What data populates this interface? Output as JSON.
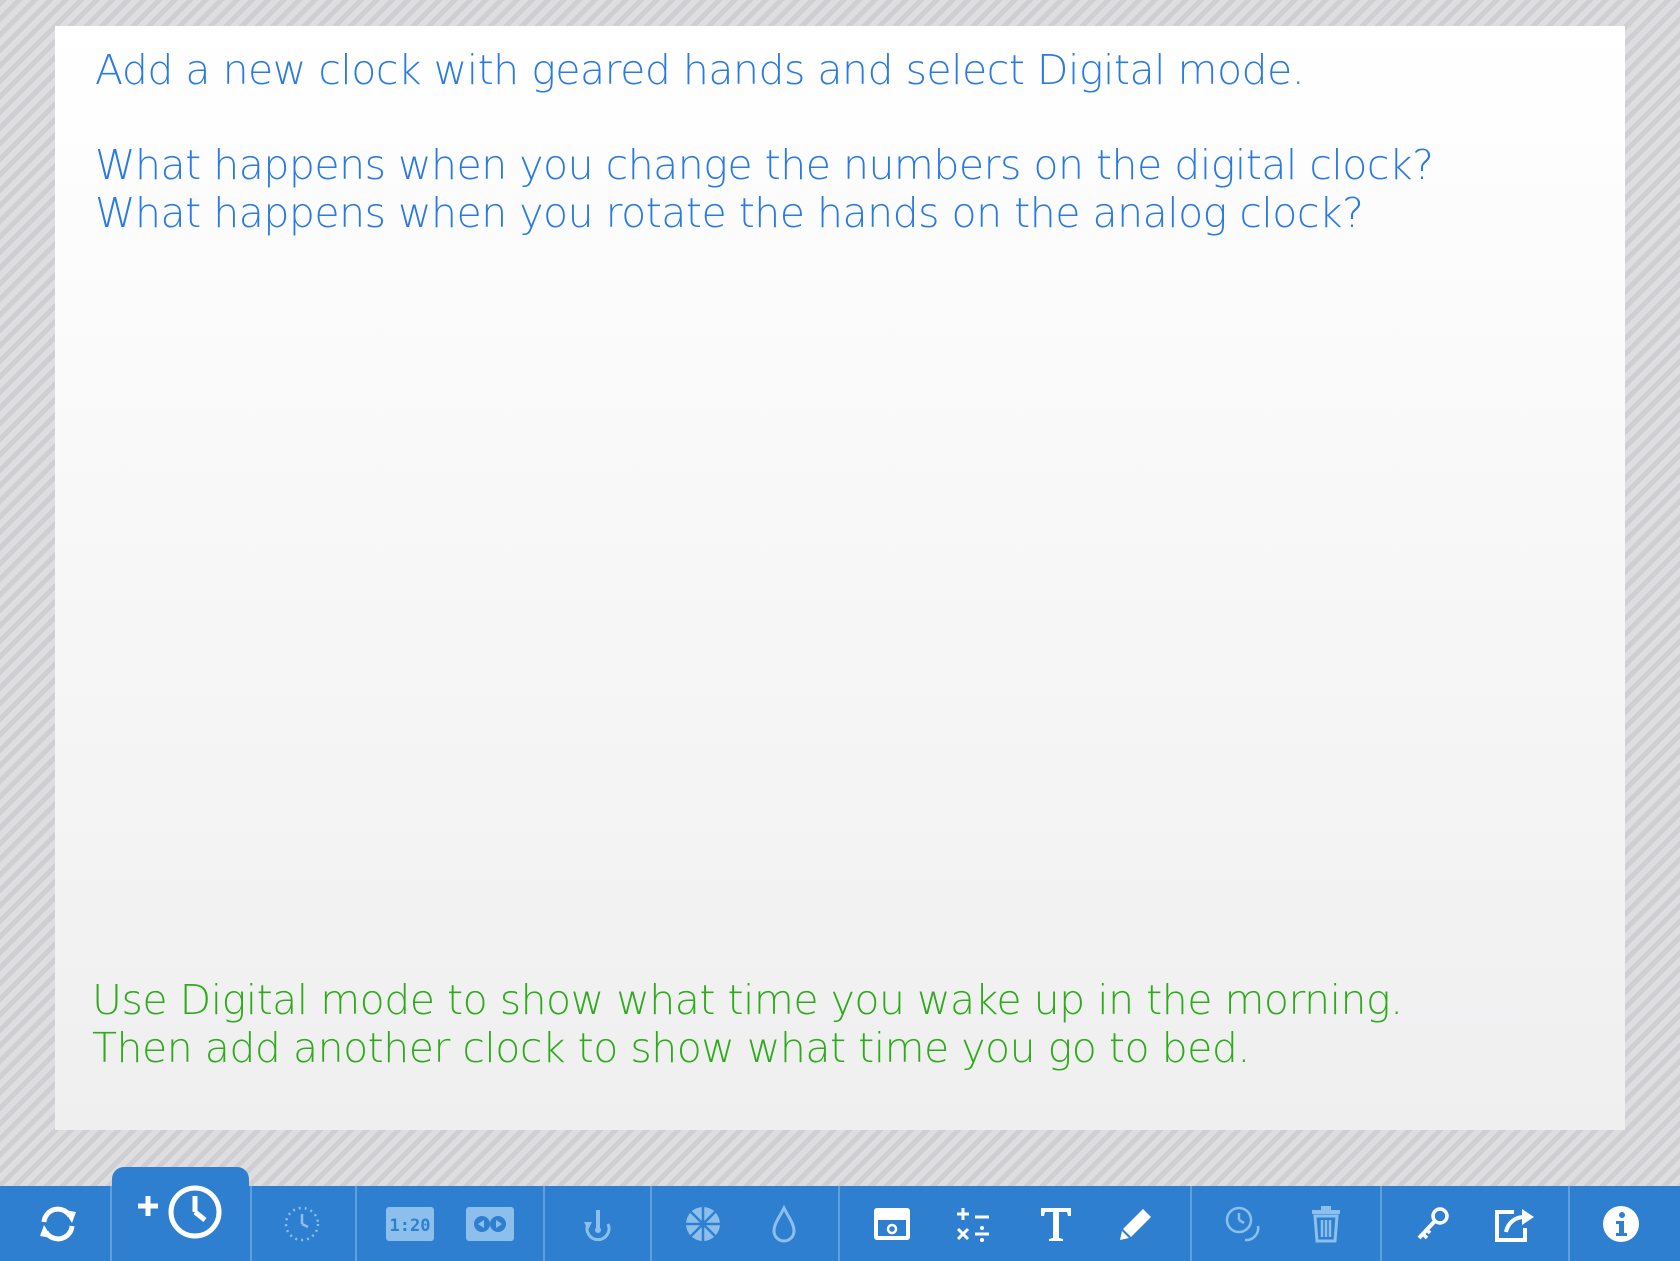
{
  "instructions": {
    "line1": "Add a new clock with geared hands and select Digital mode.",
    "line2": "What happens when you change the numbers on the digital clock?",
    "line3": "What happens when you rotate the hands on the analog clock?"
  },
  "task": {
    "line1": "Use Digital mode to show what time you wake up in the morning.",
    "line2": "Then add another clock to show what time you go to bed."
  },
  "colors": {
    "instructions": "#2a7ae2",
    "task": "#2eab1b",
    "toolbar": "#2e7fd0"
  },
  "toolbar": {
    "buttons": [
      {
        "icon": "reset-icon",
        "enabled": true
      },
      {
        "icon": "add-clock-icon",
        "enabled": true
      },
      {
        "icon": "clock-face-icon",
        "enabled": false
      },
      {
        "icon": "digital-display-icon",
        "enabled": false
      },
      {
        "icon": "digital-toggle-icon",
        "enabled": false
      },
      {
        "icon": "rotate-hands-icon",
        "enabled": false
      },
      {
        "icon": "color-wheel-icon",
        "enabled": false
      },
      {
        "icon": "fill-drop-icon",
        "enabled": false
      },
      {
        "icon": "background-icon",
        "enabled": true
      },
      {
        "icon": "math-operators-icon",
        "enabled": true
      },
      {
        "icon": "text-icon",
        "enabled": true
      },
      {
        "icon": "pencil-icon",
        "enabled": true
      },
      {
        "icon": "duplicate-clock-icon",
        "enabled": false
      },
      {
        "icon": "trash-icon",
        "enabled": false
      },
      {
        "icon": "key-icon",
        "enabled": true
      },
      {
        "icon": "share-icon",
        "enabled": true
      },
      {
        "icon": "info-icon",
        "enabled": true
      }
    ]
  }
}
